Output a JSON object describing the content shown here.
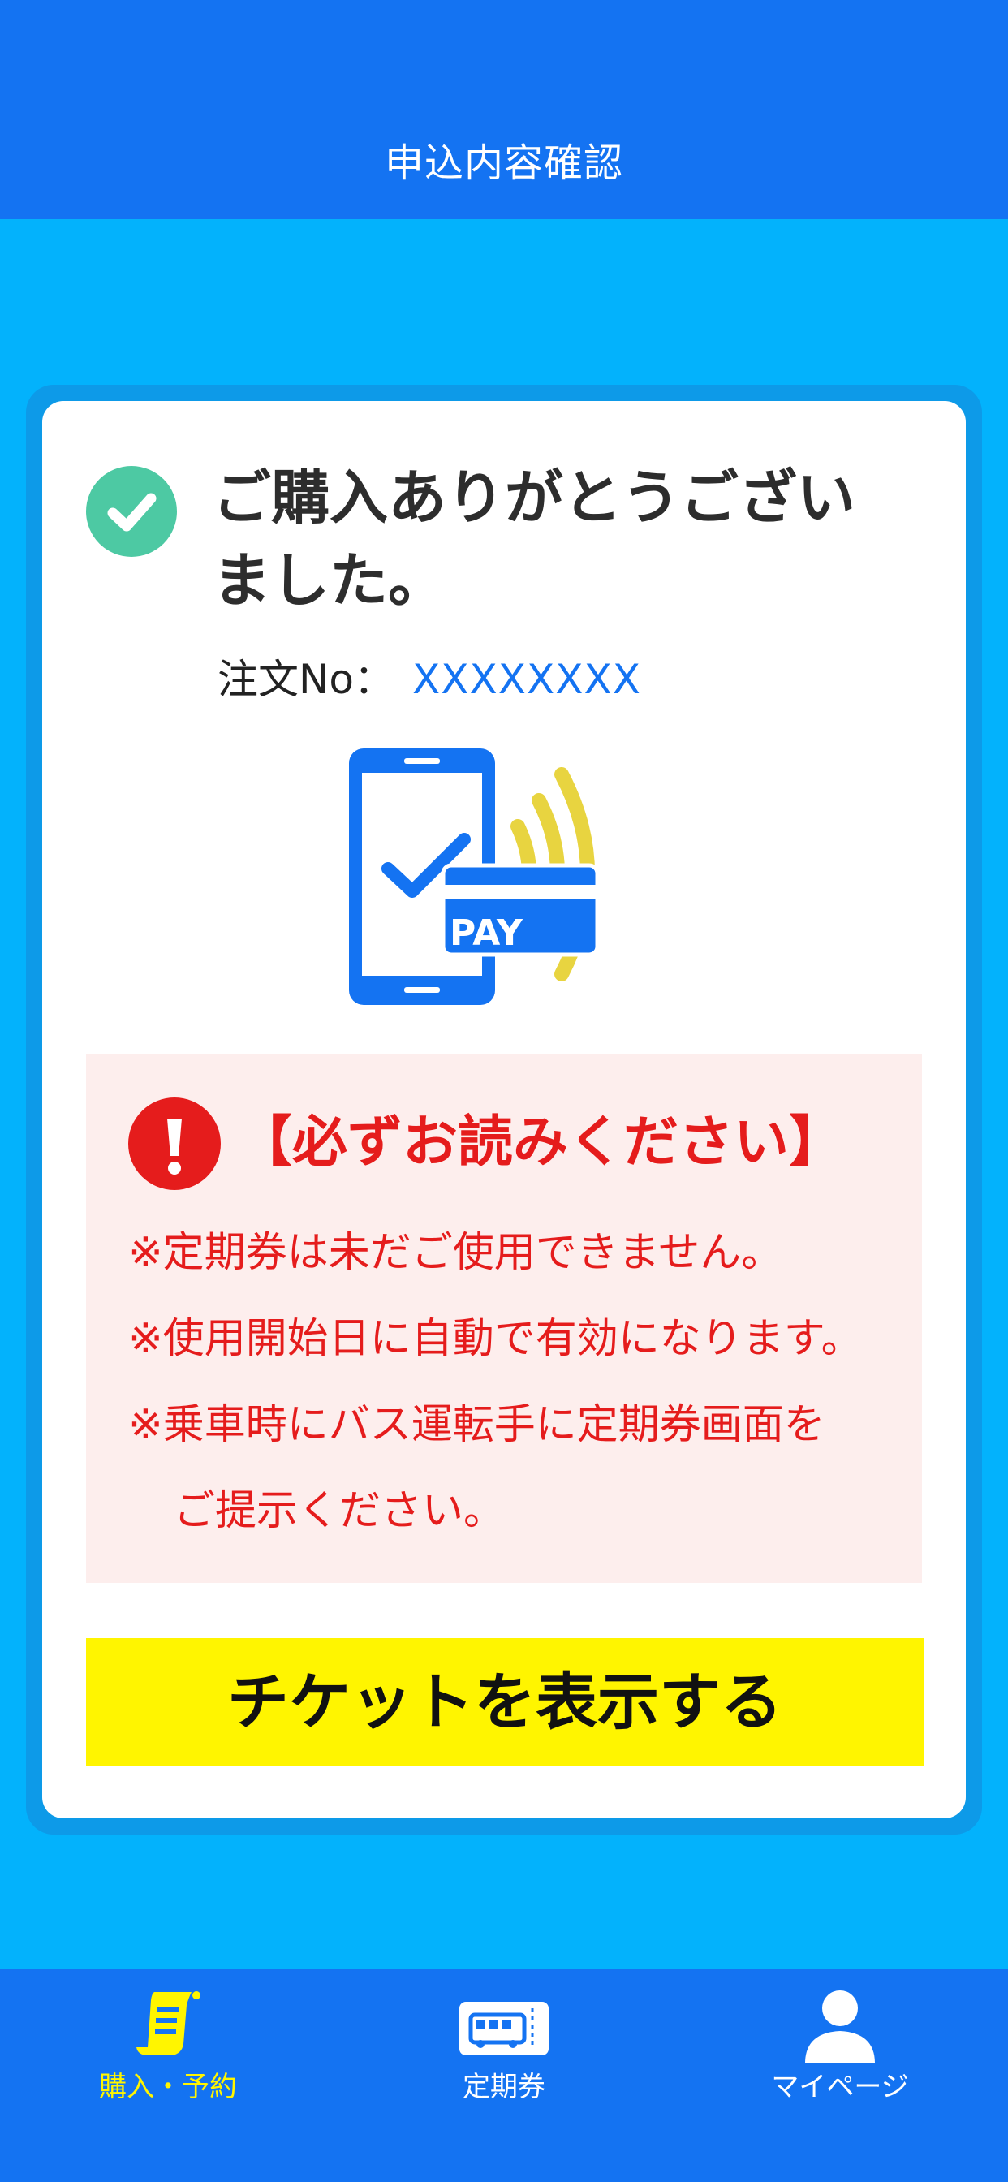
{
  "header": {
    "title": "申込内容確認"
  },
  "completion": {
    "message_line1": "ご購入ありがとうござい",
    "message_line2": "ました。",
    "order_label": "注文No：",
    "order_number": "XXXXXXXX"
  },
  "illustration": {
    "pay_text": "PAY"
  },
  "notice": {
    "title": "【必ずお読みください】",
    "lines": [
      "※定期券は未だご使用できません。",
      "※使用開始日に自動で有効になります。",
      "※乗車時にバス運転手に定期券画面を",
      "ご提示ください。"
    ]
  },
  "actions": {
    "show_ticket_label": "チケットを表示する"
  },
  "tabbar": {
    "items": [
      {
        "label": "購入・予約",
        "icon": "receipt-icon",
        "active": true
      },
      {
        "label": "定期券",
        "icon": "bus-pass-icon",
        "active": false
      },
      {
        "label": "マイページ",
        "icon": "user-icon",
        "active": false
      }
    ]
  },
  "colors": {
    "header_blue": "#1473f2",
    "background_cyan": "#03b2fc",
    "check_green": "#4dc9a3",
    "alert_red": "#e51c1c",
    "notice_bg": "#fdeeed",
    "button_yellow": "#fff500",
    "nfc_wave_yellow": "#e8d440"
  }
}
